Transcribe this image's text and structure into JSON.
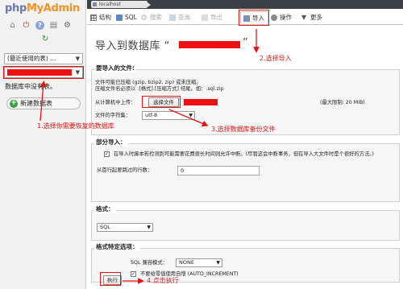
{
  "sidebar": {
    "logo_part1": "php",
    "logo_part2": "MyAdmin",
    "icons": [
      "home-icon",
      "exit-icon",
      "help-icon",
      "docs-icon",
      "settings-icon",
      "reload-icon"
    ],
    "recent_select": "(最近使用的表) ...",
    "no_tables": "数据库中没有表。",
    "new_table_button": "新建数据表"
  },
  "breadcrumb": {
    "server": "localhost"
  },
  "tabs": [
    {
      "label": "结构",
      "icon": "structure-icon",
      "state": "normal"
    },
    {
      "label": "SQL",
      "icon": "sql-icon",
      "state": "normal"
    },
    {
      "label": "搜索",
      "icon": "search-icon",
      "state": "disabled"
    },
    {
      "label": "查询",
      "icon": "query-icon",
      "state": "disabled"
    },
    {
      "label": "导出",
      "icon": "export-icon",
      "state": "disabled"
    },
    {
      "label": "导入",
      "icon": "import-icon",
      "state": "active"
    },
    {
      "label": "操作",
      "icon": "operations-icon",
      "state": "normal"
    },
    {
      "label": "更多",
      "icon": "more-icon",
      "state": "normal"
    }
  ],
  "main": {
    "page_title": "导入到数据库 “",
    "page_title_end": "”",
    "file_section": {
      "title": "要导入的文件:",
      "compress_note_1": "文件可能已压缩 (gzip, bzip2, zip) 或未压缩。",
      "compress_note_2": "压缩文件名必须以 .[格式].[压缩方式] 结尾。如：.sql.zip",
      "upload_label": "从计算机中上传：",
      "choose_file_button": "选择文件",
      "max_limit": "(最大限制: 20 MiB)",
      "charset_label": "文件的字符集：",
      "charset_value": "utf-8"
    },
    "partial_section": {
      "title": "部分导入：",
      "allow_interrupt": "在导入时脚本若检测到可能需要花费很长时间则允许中断。(尽管这会中断事务，但在导入大文件时是个很好的方法。)",
      "skip_label": "从首行起要跳过的行数：",
      "skip_value": "0"
    },
    "format_section": {
      "title": "格式：",
      "format_value": "SQL"
    },
    "options_section": {
      "title": "格式特定选项：",
      "compat_label": "SQL 兼容模式：",
      "compat_value": "NONE",
      "no_auto_zero": "不要给零值使用自增 (AUTO_INCREMENT)"
    },
    "go_button": "执行"
  },
  "annotations": {
    "step1": "1.选择你需要恢复的数据库",
    "step2": "2.选择导入",
    "step3": "3.选择数据库备份文件",
    "step4": "4.点击执行"
  },
  "colors": {
    "annotation": "#ee1111",
    "logo_php": "#6c78af",
    "logo_admin": "#f29324"
  }
}
